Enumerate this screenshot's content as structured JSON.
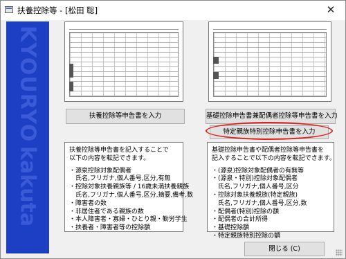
{
  "window": {
    "title": "扶養控除等 - [松田 聡]",
    "close_icon": "close-icon"
  },
  "banner": {
    "text": "KYOURYO",
    "text2": "kakuta",
    "color": "#1c3fc4"
  },
  "left": {
    "button_label": "扶養控除等申告書を入力",
    "description": [
      "扶養控除等申告書を記入することで",
      "以下の内容を転記できます。",
      "",
      "・源泉控除対象配偶者",
      "　氏名,フリガナ,個人番号,区分,有無",
      "・控除対象扶養親族等 / 16歳未満扶養親族",
      "　氏名,フリガナ,個人番号,区分,摘要,備考,数",
      "・障害者の数",
      "・非居住者である親族の数",
      "・本人障害者・寡婦・ひとり親・勤労学生",
      "・扶養者・障害者等の控除額"
    ]
  },
  "right": {
    "button_label": "基礎控除申告書兼配偶者控除等申告書を入力",
    "button2_label": "特定親族特別控除申告書を入力",
    "highlight_color": "#e0201c",
    "description": [
      "基礎控除申告書や配偶者控除等申告書を",
      "記入することで以下の内容を転記できます。",
      "",
      "・(源泉)控除対象配偶者の有無等",
      "・(源泉・特別)控除対象配偶者",
      "　氏名,フリガナ,個人番号,区分",
      "・控除対象扶養親族(特定親族)",
      "　氏名,フリガナ,個人番号,区分,数",
      "・配偶者(特別)控除の額",
      "・配偶者の合計所得",
      "・基礎控除額",
      "・特定親族特別控除の額"
    ]
  },
  "footer": {
    "close_label": "閉じる (C)"
  }
}
